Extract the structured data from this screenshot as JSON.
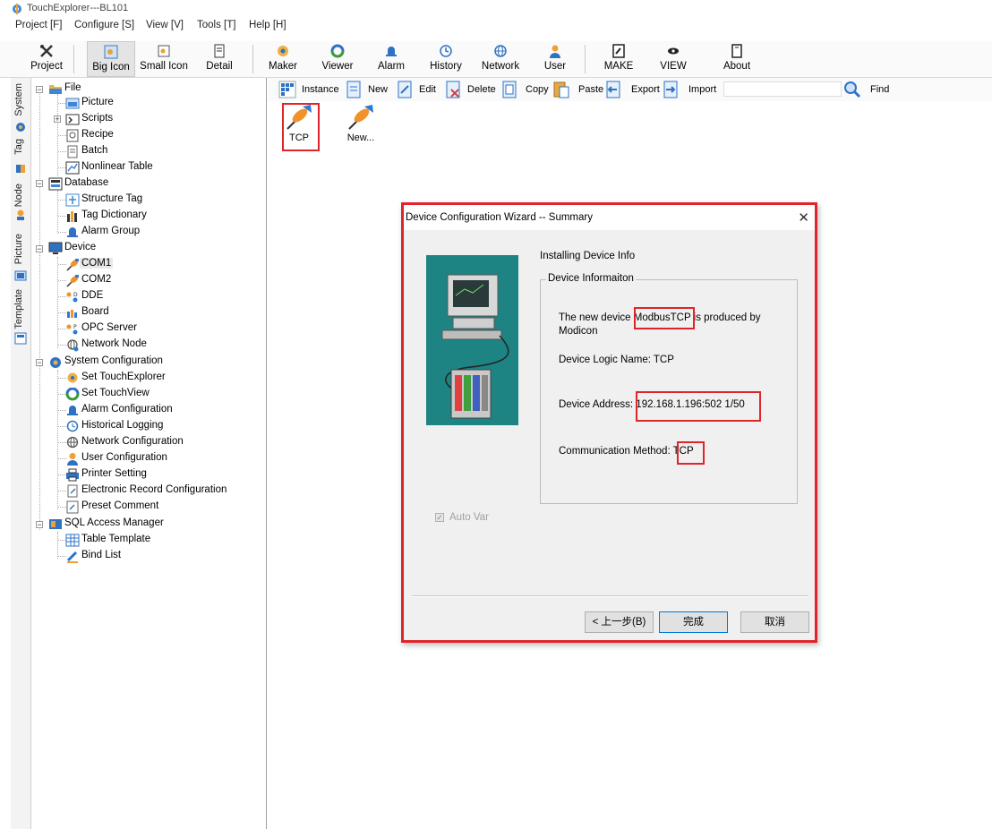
{
  "app": {
    "title": "TouchExplorer---BL101"
  },
  "menu": [
    "Project [F]",
    "Configure [S]",
    "View [V]",
    "Tools [T]",
    "Help [H]"
  ],
  "toolbar": {
    "project": "Project",
    "big_icon": "Big Icon",
    "small_icon": "Small Icon",
    "detail": "Detail",
    "maker": "Maker",
    "viewer": "Viewer",
    "alarm": "Alarm",
    "history": "History",
    "network": "Network",
    "user": "User",
    "make": "MAKE",
    "view": "VIEW",
    "about": "About"
  },
  "side_tabs": [
    "System",
    "Tag",
    "Node",
    "Picture",
    "Template"
  ],
  "tree": {
    "file": "File",
    "picture": "Picture",
    "scripts": "Scripts",
    "recipe": "Recipe",
    "batch": "Batch",
    "nonlinear_table": "Nonlinear Table",
    "database": "Database",
    "structure_tag": "Structure Tag",
    "tag_dictionary": "Tag Dictionary",
    "alarm_group": "Alarm Group",
    "device": "Device",
    "com1": "COM1",
    "com2": "COM2",
    "dde": "DDE",
    "board": "Board",
    "opc_server": "OPC Server",
    "network_node": "Network Node",
    "system_configuration": "System Configuration",
    "set_touchexplorer": "Set TouchExplorer",
    "set_touchview": "Set TouchView",
    "alarm_configuration": "Alarm Configuration",
    "historical_logging": "Historical Logging",
    "network_configuration": "Network Configuration",
    "user_configuration": "User Configuration",
    "printer_setting": "Printer Setting",
    "electronic_record_configuration": "Electronic Record Configuration",
    "preset_comment": "Preset Comment",
    "sql_access_manager": "SQL Access Manager",
    "table_template": "Table Template",
    "bind_list": "Bind List"
  },
  "content_toolbar": {
    "instance": "Instance",
    "new": "New",
    "edit": "Edit",
    "delete": "Delete",
    "copy": "Copy",
    "paste": "Paste",
    "export": "Export",
    "import": "Import",
    "find": "Find",
    "search_value": ""
  },
  "content_items": [
    "TCP",
    "New..."
  ],
  "dialog": {
    "title": "Device Configuration Wizard -- Summary",
    "close": "✕",
    "heading": "Installing Device Info",
    "group_title": "Device Informaiton",
    "line1_prefix": "The new device ",
    "device_name": "ModbusTCP",
    "line1_suffix": " is produced by",
    "manufacturer": "Modicon",
    "logic_name": "Device Logic Name: TCP",
    "address_label": "Device Address: ",
    "address_value": "192.168.1.196:502 1/50",
    "comm_label": "Communication Method: ",
    "comm_value": "TCP",
    "auto_var": "Auto Var",
    "auto_var_checked": true,
    "btn_back": "< 上一步(B)",
    "btn_finish": "完成",
    "btn_cancel": "取消"
  },
  "colors": {
    "highlight_red": "#e0242a",
    "dialog_image_teal": "#1e8383",
    "device_orange": "#f0912a",
    "device_blue": "#2b7bd6"
  }
}
